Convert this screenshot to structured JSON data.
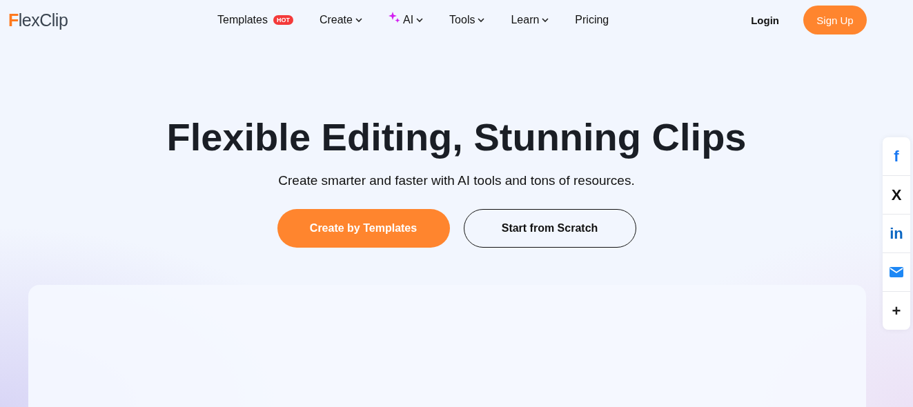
{
  "logo": "FlexClip",
  "nav": [
    {
      "label": "Templates",
      "badge": "HOT",
      "dropdown": false,
      "sparkle": false
    },
    {
      "label": "Create",
      "dropdown": true,
      "sparkle": false
    },
    {
      "label": "AI",
      "dropdown": true,
      "sparkle": true
    },
    {
      "label": "Tools",
      "dropdown": true,
      "sparkle": false
    },
    {
      "label": "Learn",
      "dropdown": true,
      "sparkle": false
    },
    {
      "label": "Pricing",
      "dropdown": false,
      "sparkle": false
    }
  ],
  "login": "Login",
  "signup": "Sign Up",
  "hero": {
    "title": "Flexible Editing, Stunning Clips",
    "subtitle": "Create smarter and faster with AI tools and tons of resources.",
    "primary": "Create by Templates",
    "secondary": "Start from Scratch"
  },
  "share": [
    {
      "kind": "glyph",
      "label": "f",
      "color": "#1877f2"
    },
    {
      "kind": "glyph",
      "label": "X",
      "color": "#111111"
    },
    {
      "kind": "glyph",
      "label": "in",
      "color": "#0a66c2"
    },
    {
      "kind": "mail",
      "color": "#1e88f5"
    },
    {
      "kind": "glyph",
      "label": "+",
      "color": "#222222"
    }
  ]
}
